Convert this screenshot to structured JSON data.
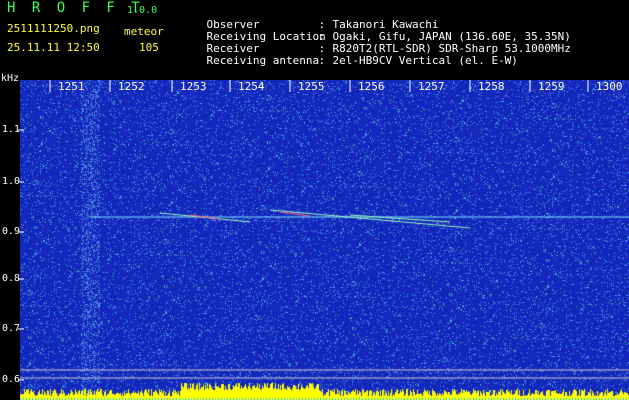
{
  "app": {
    "title": "H R O F F T",
    "version": "1.0.0"
  },
  "file": {
    "name": "2511111250.png",
    "datetime": "25.11.11 12:50"
  },
  "meteor": {
    "label": "meteor",
    "count": "105"
  },
  "info": [
    {
      "key": "Observer",
      "value": "Takanori Kawachi"
    },
    {
      "key": "Receiving Location",
      "value": "Ogaki, Gifu, JAPAN (136.60E, 35.35N)"
    },
    {
      "key": "Receiver",
      "value": "R820T2(RTL-SDR) SDR-Sharp 53.1000MHz"
    },
    {
      "key": "Receiving antenna",
      "value": "2el-HB9CV Vertical (el. E-W)"
    }
  ],
  "axis": {
    "unit": "kHz",
    "time_ticks": [
      "1251",
      "1252",
      "1253",
      "1254",
      "1255",
      "1256",
      "1257",
      "1258",
      "1259",
      "1300"
    ],
    "freq_ticks": [
      "1.1",
      "1.0",
      "0.9",
      "0.8",
      "0.7",
      "0.6"
    ]
  },
  "colors": {
    "background": "#000000",
    "spectrum_base": "#1a2fb8",
    "header_green": "#39ff5a",
    "signal_yellow": "#ffff00"
  }
}
